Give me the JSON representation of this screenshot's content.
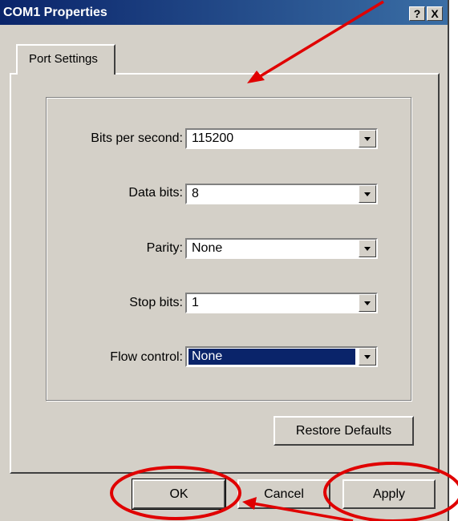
{
  "window": {
    "title": "COM1 Properties",
    "help_button": "?",
    "close_button": "X"
  },
  "tabs": [
    {
      "label": "Port Settings"
    }
  ],
  "fields": [
    {
      "label": "Bits per second:",
      "value": "115200"
    },
    {
      "label": "Data bits:",
      "value": "8"
    },
    {
      "label": "Parity:",
      "value": "None"
    },
    {
      "label": "Stop bits:",
      "value": "1"
    },
    {
      "label": "Flow control:",
      "value": "None"
    }
  ],
  "buttons": {
    "restore_defaults": "Restore Defaults",
    "ok": "OK",
    "cancel": "Cancel",
    "apply": "Apply"
  },
  "colors": {
    "titlebar": "#0a246a",
    "face": "#d4d0c8",
    "annotation": "#e00000"
  }
}
